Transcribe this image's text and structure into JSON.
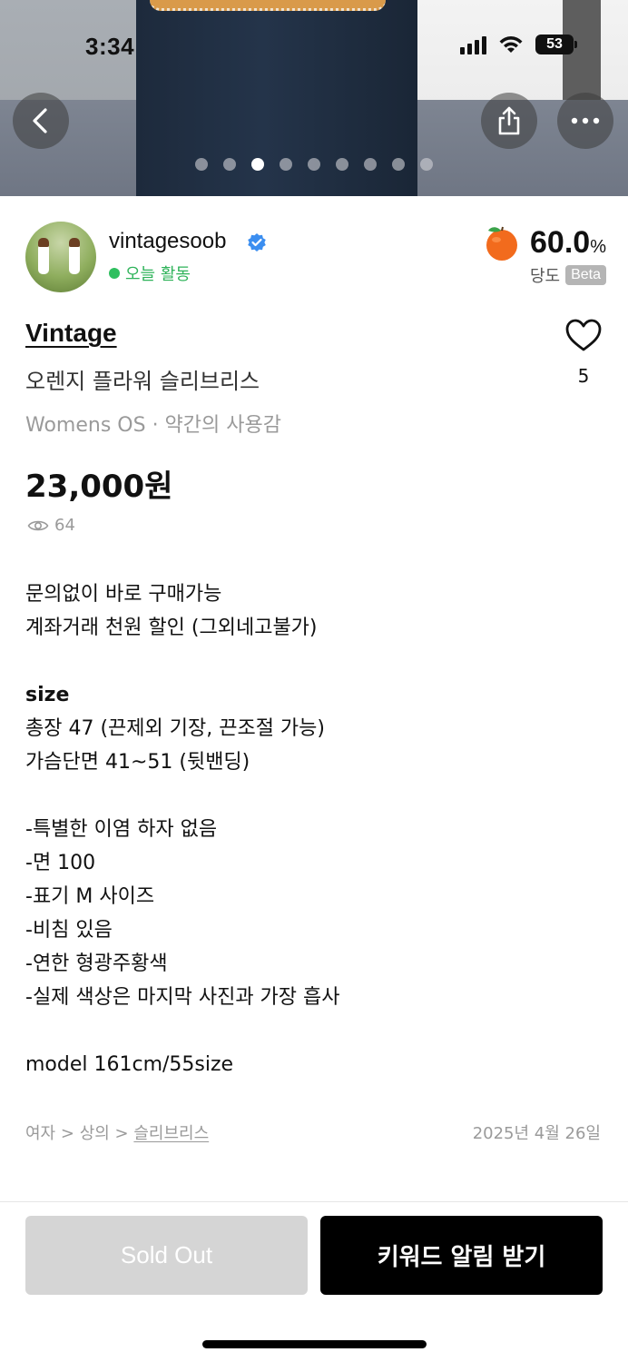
{
  "status_bar": {
    "time": "3:34",
    "battery": "53"
  },
  "gallery": {
    "total_images": 9,
    "active_index": 2
  },
  "seller": {
    "name": "vintagesoob",
    "activity": "오늘 활동",
    "rating_value": "60.0",
    "rating_unit": "%",
    "rating_label": "당도",
    "rating_badge": "Beta"
  },
  "product": {
    "brand": "Vintage",
    "title": "오렌지 플라워 슬리브리스",
    "meta": "Womens OS · 약간의 사용감",
    "price": "23,000원",
    "views": "64",
    "likes": "5"
  },
  "description": [
    {
      "text": "문의없이 바로 구매가능",
      "bold": false
    },
    {
      "text": "계좌거래 천원 할인 (그외네고불가)",
      "bold": false
    },
    {
      "text": "",
      "bold": false
    },
    {
      "text": "size",
      "bold": true
    },
    {
      "text": "총장 47 (끈제외 기장, 끈조절 가능)",
      "bold": false
    },
    {
      "text": "가슴단면 41~51 (뒷밴딩)",
      "bold": false
    },
    {
      "text": "",
      "bold": false
    },
    {
      "text": "-특별한 이염 하자 없음",
      "bold": false
    },
    {
      "text": "-면 100",
      "bold": false
    },
    {
      "text": "-표기 M 사이즈",
      "bold": false
    },
    {
      "text": "-비침 있음",
      "bold": false
    },
    {
      "text": "-연한 형광주황색",
      "bold": false
    },
    {
      "text": "-실제 색상은 마지막 사진과 가장 흡사",
      "bold": false
    },
    {
      "text": "",
      "bold": false
    },
    {
      "text": "model 161cm/55size",
      "bold": false
    }
  ],
  "category": {
    "level1": "여자",
    "separator": ">",
    "level2": "상의",
    "level3": "슬리브리스"
  },
  "posted_date": "2025년 4월 26일",
  "actions": {
    "sold_out_label": "Sold Out",
    "keyword_alert_label": "키워드 알림 받기"
  },
  "colors": {
    "accent_green": "#2fb35a",
    "verified_blue": "#3b8ef0",
    "orange": "#f26b1d"
  }
}
